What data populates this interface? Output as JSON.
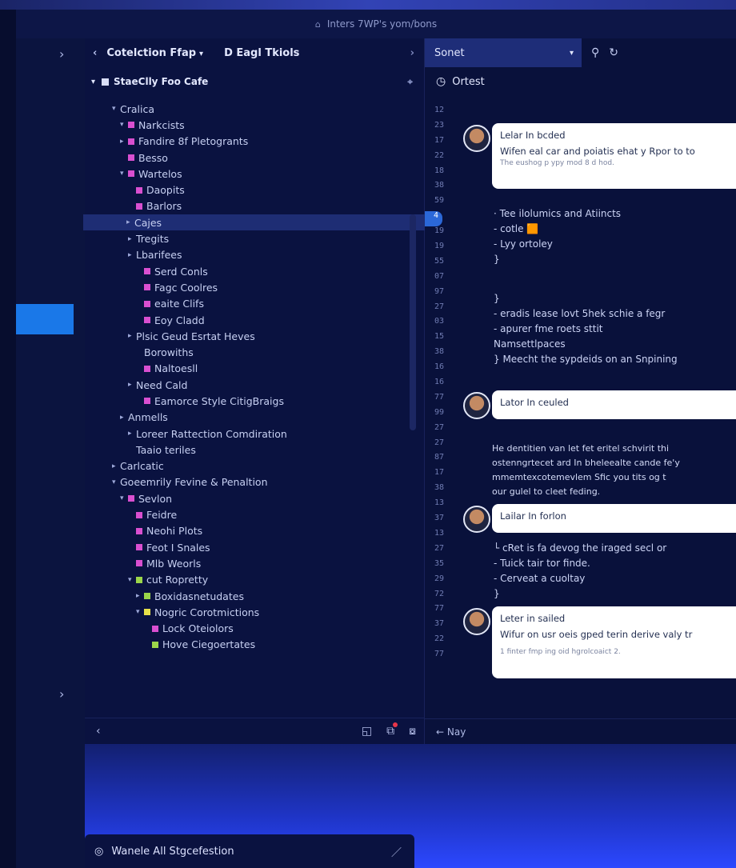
{
  "window": {
    "title": "Inters 7WP's yom/bons",
    "lock_icon": "lock-icon"
  },
  "rail": {
    "top_arrow": "›",
    "bottom_arrow": "›"
  },
  "sidebar": {
    "back": "‹",
    "selector1": "Cotelction Ffap",
    "selector2": "D Eagl Tkiols",
    "forward": "›",
    "section_title": "StaeClly Foo Cafe",
    "tree": [
      {
        "label": "Cralica",
        "indent": 0,
        "caret": "▾",
        "color": ""
      },
      {
        "label": "Narkcists",
        "indent": 1,
        "caret": "▾",
        "color": "#d94fd0"
      },
      {
        "label": "Fandire 8f Pletogrants",
        "indent": 1,
        "caret": "▸",
        "color": "#d94fd0"
      },
      {
        "label": "Besso",
        "indent": 1,
        "caret": "",
        "color": "#d94fd0"
      },
      {
        "label": "Wartelos",
        "indent": 1,
        "caret": "▾",
        "color": "#d94fd0"
      },
      {
        "label": "Daopits",
        "indent": 2,
        "caret": "",
        "color": "#d94fd0"
      },
      {
        "label": "Barlors",
        "indent": 2,
        "caret": "",
        "color": "#d94fd0"
      },
      {
        "label": "Cajes",
        "indent": 2,
        "caret": "▸",
        "color": "",
        "selected": true
      },
      {
        "label": "Tregits",
        "indent": 2,
        "caret": "▸",
        "color": ""
      },
      {
        "label": "Lbarifees",
        "indent": 2,
        "caret": "▸",
        "color": ""
      },
      {
        "label": "Serd Conls",
        "indent": 3,
        "caret": "",
        "color": "#d94fd0"
      },
      {
        "label": "Fagc Coolres",
        "indent": 3,
        "caret": "",
        "color": "#d94fd0"
      },
      {
        "label": "eaite Clifs",
        "indent": 3,
        "caret": "",
        "color": "#d94fd0"
      },
      {
        "label": "Eoy Cladd",
        "indent": 3,
        "caret": "",
        "color": "#d94fd0"
      },
      {
        "label": "Plsic Geud Esrtat Heves",
        "indent": 2,
        "caret": "▸",
        "color": ""
      },
      {
        "label": "Borowiths",
        "indent": 3,
        "caret": "",
        "color": ""
      },
      {
        "label": "Naltoesll",
        "indent": 3,
        "caret": "",
        "color": "#d94fd0"
      },
      {
        "label": "Need Cald",
        "indent": 2,
        "caret": "▸",
        "color": ""
      },
      {
        "label": "Eamorce Style CitigBraigs",
        "indent": 3,
        "caret": "",
        "color": "#d94fd0"
      },
      {
        "label": "Anmells",
        "indent": 1,
        "caret": "▸",
        "color": ""
      },
      {
        "label": "Loreer Rattection Comdiration",
        "indent": 2,
        "caret": "▸",
        "color": ""
      },
      {
        "label": "Taaio teriles",
        "indent": 2,
        "caret": "",
        "color": ""
      },
      {
        "label": "Carlcatic",
        "indent": 0,
        "caret": "▸",
        "color": ""
      },
      {
        "label": "Goeemrily Fevine & Penaltion",
        "indent": 0,
        "caret": "▾",
        "color": ""
      },
      {
        "label": "Sevlon",
        "indent": 1,
        "caret": "▾",
        "color": "#d94fd0"
      },
      {
        "label": "Feidre",
        "indent": 2,
        "caret": "",
        "color": "#d94fd0"
      },
      {
        "label": "Neohi Plots",
        "indent": 2,
        "caret": "",
        "color": "#d94fd0"
      },
      {
        "label": "Feot I Snales",
        "indent": 2,
        "caret": "",
        "color": "#d94fd0"
      },
      {
        "label": "Mlb Weorls",
        "indent": 2,
        "caret": "",
        "color": "#d94fd0"
      },
      {
        "label": "cut Ropretty",
        "indent": 2,
        "caret": "▾",
        "color": "#9bd64a"
      },
      {
        "label": "Boxidasnetudates",
        "indent": 3,
        "caret": "▸",
        "color": "#9bd64a"
      },
      {
        "label": "Nogric Corotmictions",
        "indent": 3,
        "caret": "▾",
        "color": "#e6e04a"
      },
      {
        "label": "Lock Oteiolors",
        "indent": 4,
        "caret": "",
        "color": "#d94fd0"
      },
      {
        "label": "Hove Ciegoertates",
        "indent": 4,
        "caret": "",
        "color": "#9bd64a"
      }
    ],
    "footer_back": "‹"
  },
  "main": {
    "selector": "Sonet",
    "title": "Ortest",
    "lines": [
      "12",
      "23",
      "17",
      "22",
      "18",
      "38",
      "59",
      "4",
      "19",
      "19",
      "55",
      "07",
      "97",
      "27",
      "03",
      "15",
      "38",
      "16",
      "16",
      "77",
      "99",
      "27",
      "27",
      "87",
      "17",
      "38",
      "13",
      "37",
      "13",
      "27",
      "35",
      "29",
      "72",
      "77",
      "37",
      "22",
      "77"
    ],
    "highlight_line_index": 7,
    "messages": [
      {
        "name": "Lelar In bcded",
        "text": "Wifen eal car and poiatis ehat y Rpor to to",
        "sub": "The eushog p ypy mod 8 d hod."
      },
      {
        "name": "Lator In ceuled",
        "text": "",
        "sub": ""
      },
      {
        "name": "Lailar In forlon",
        "text": "",
        "sub": ""
      },
      {
        "name": "Leter in sailed",
        "text": "Wifur on usr oeis gped terin derive valy tr",
        "sub": "1 finter fmp ing oid hgrolcoaict 2."
      }
    ],
    "code1": [
      "· Tee ilolumics and Atiincts",
      "  - cotle 🟧",
      "  - Lyy ortoley",
      "}"
    ],
    "code2": [
      "}",
      "- eradis lease lovt 5hek schie a fegr",
      "- apurer fme roets sttit",
      "  Namsettlpaces",
      "} Meecht the sypdeids on an Snpining"
    ],
    "para": [
      "He dentitien van let fet eritel schvirit thi",
      "ostenngrtecet ard In bheleealte cande fe'y",
      "mmemtexcotemevlem Sfic you tits og t",
      "our gulel to cleet feding."
    ],
    "code3": [
      "└ cRet is fa devog the iraged secl or",
      "  - Tuick tair tor finde.",
      "  - Cerveat a cuoltay",
      "}"
    ],
    "footer_label": "← Nay"
  },
  "bottom": {
    "label": "Wanele All Stgcefestion"
  }
}
